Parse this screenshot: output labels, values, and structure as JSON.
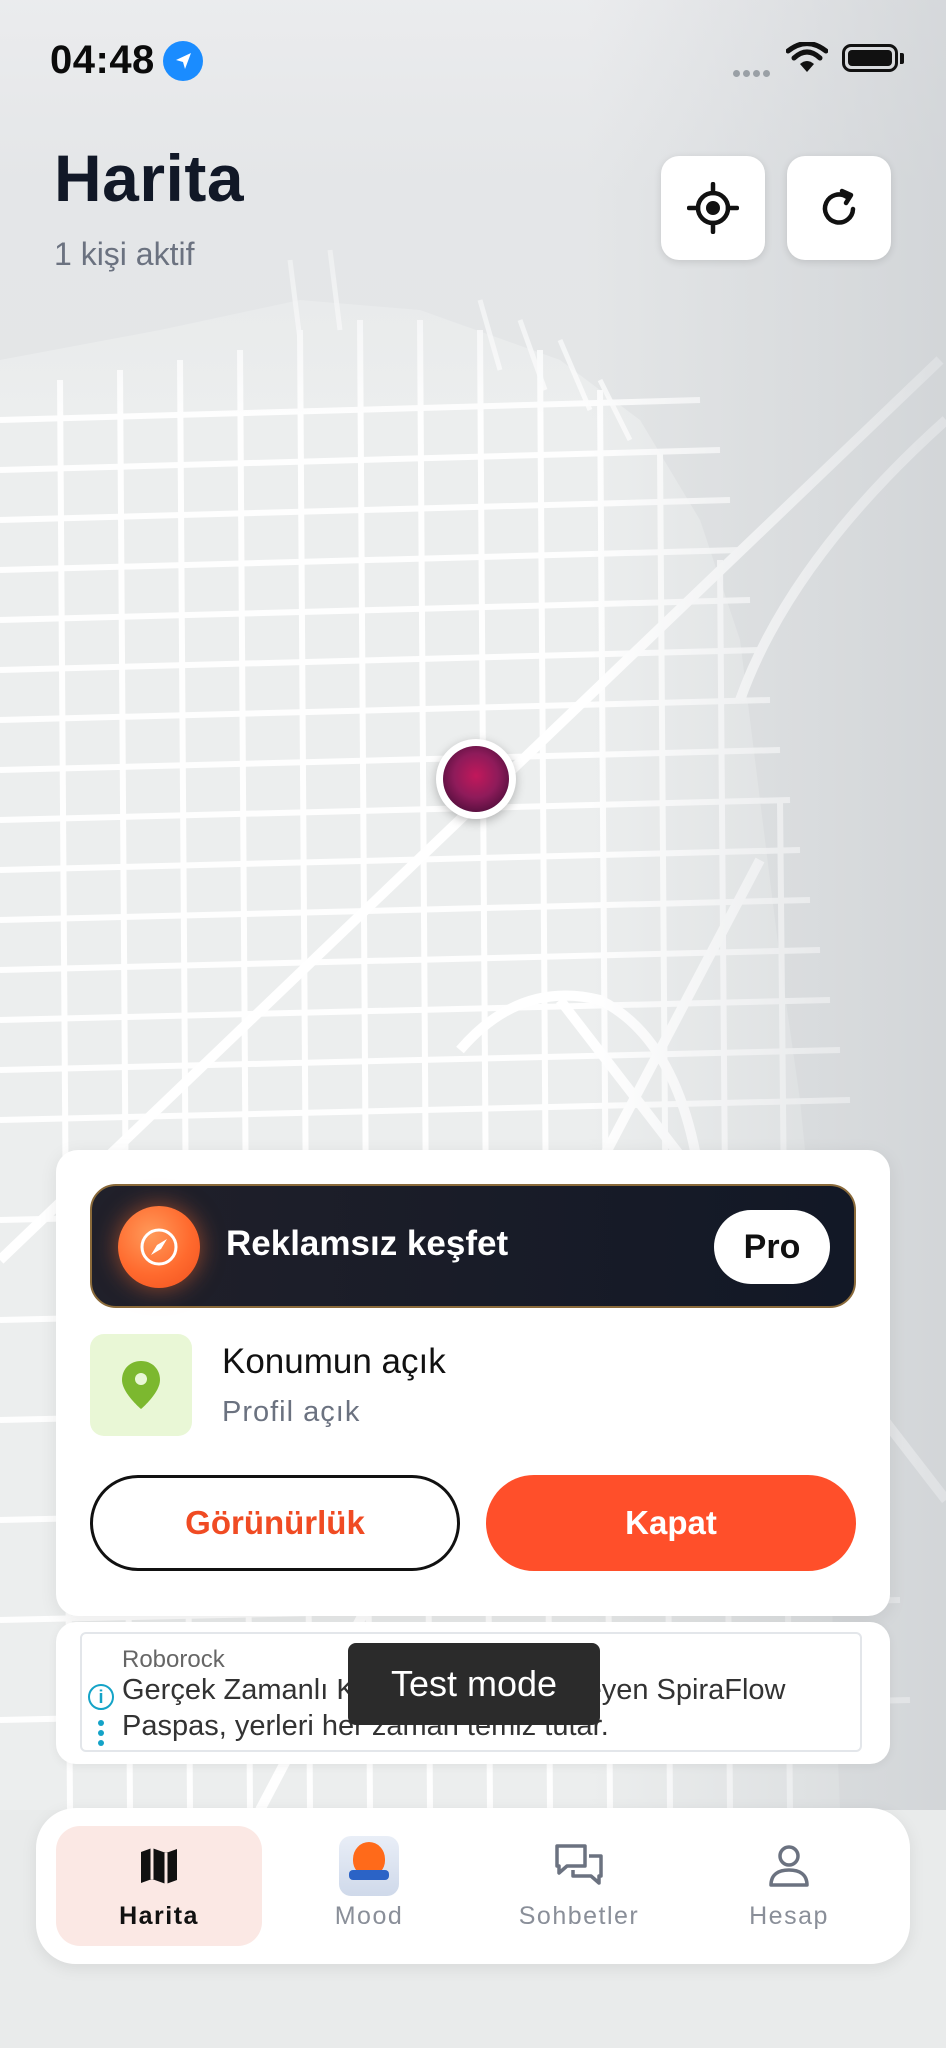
{
  "status_bar": {
    "time": "04:48"
  },
  "header": {
    "title": "Harita",
    "subtitle": "1 kişi aktif"
  },
  "promo": {
    "text": "Reklamsız keşfet",
    "pro_label": "Pro"
  },
  "location": {
    "title": "Konumun açık",
    "subtitle": "Profil açık"
  },
  "actions": {
    "visibility_label": "Görünürlük",
    "close_label": "Kapat"
  },
  "ad": {
    "brand": "Roborock",
    "line1": "Gerçek Zamanlı Kiri Algılayıp Temizleyen SpiraFlow",
    "line2": "Paspas, yerleri her zaman temiz tutar.",
    "info_glyph": "i"
  },
  "toast": {
    "text": "Test mode"
  },
  "tabs": [
    {
      "label": "Harita",
      "icon": "map-icon",
      "active": true
    },
    {
      "label": "Mood",
      "icon": "mood-app-icon",
      "active": false
    },
    {
      "label": "Sohbetler",
      "icon": "chat-bubbles-icon",
      "active": false
    },
    {
      "label": "Hesap",
      "icon": "user-icon",
      "active": false
    }
  ],
  "colors": {
    "accent": "#ff4f2a",
    "location_green": "#7cb82f",
    "promo_bg": "#121826"
  }
}
